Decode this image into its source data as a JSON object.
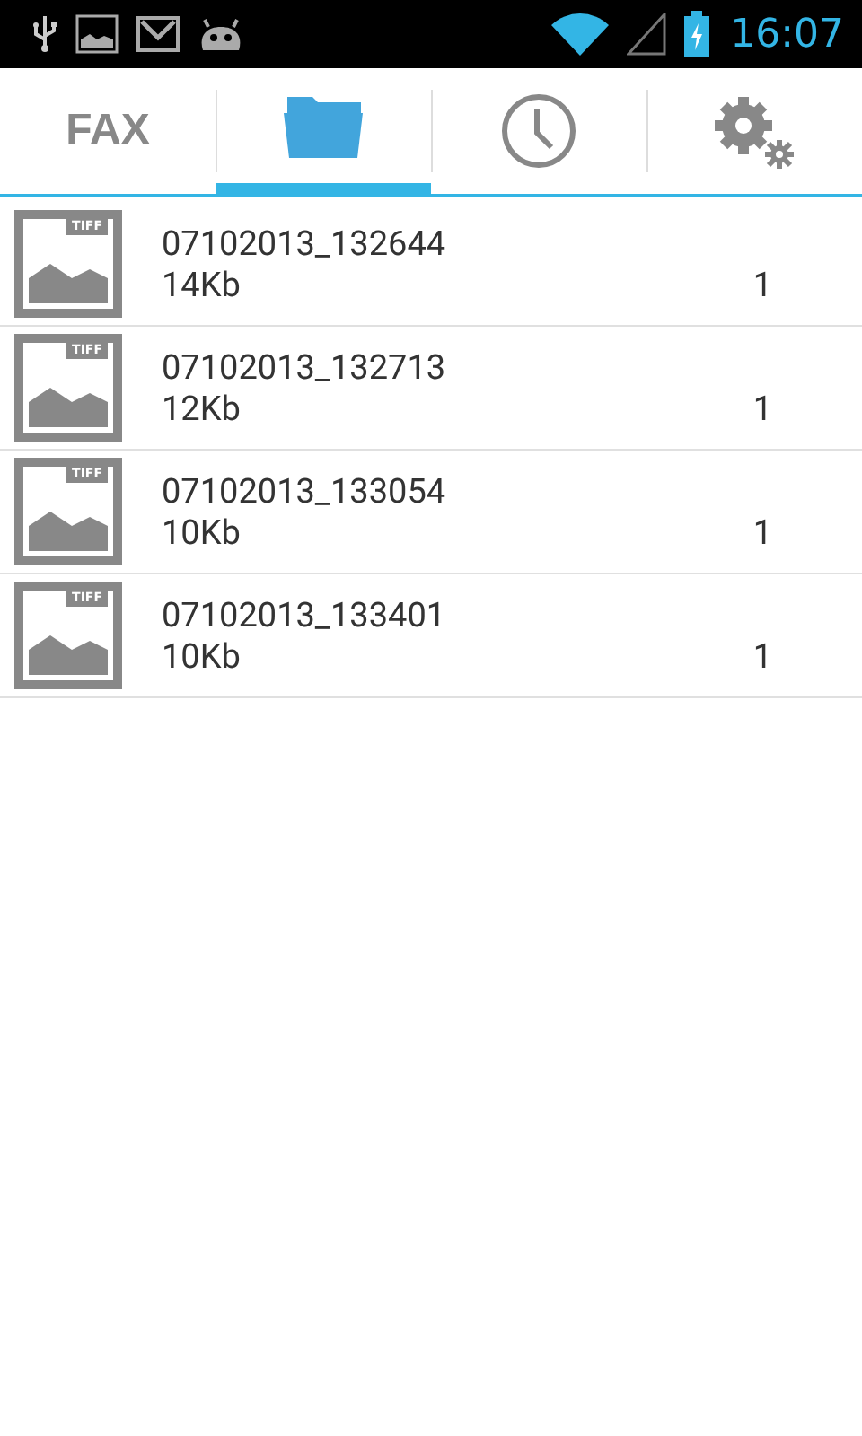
{
  "status_bar": {
    "time": "16:07"
  },
  "tabs": [
    {
      "kind": "text",
      "label": "FAX",
      "selected": false
    },
    {
      "kind": "folder",
      "selected": true
    },
    {
      "kind": "clock",
      "selected": false
    },
    {
      "kind": "gear",
      "selected": false
    }
  ],
  "files": [
    {
      "badge": "TIFF",
      "name": "07102013_132644",
      "size": "14Kb",
      "pages": "1"
    },
    {
      "badge": "TIFF",
      "name": "07102013_132713",
      "size": "12Kb",
      "pages": "1"
    },
    {
      "badge": "TIFF",
      "name": "07102013_133054",
      "size": "10Kb",
      "pages": "1"
    },
    {
      "badge": "TIFF",
      "name": "07102013_133401",
      "size": "10Kb",
      "pages": "1"
    }
  ]
}
